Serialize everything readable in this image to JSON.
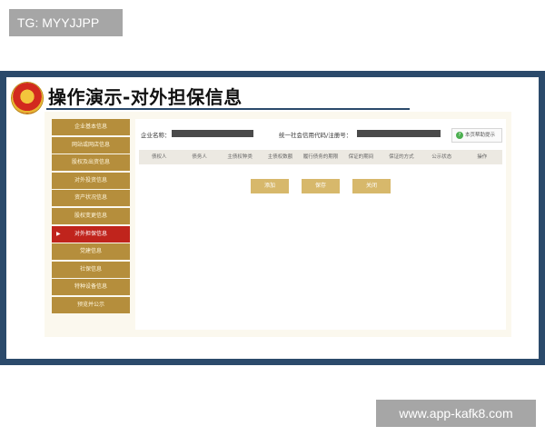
{
  "watermark_top": "TG: MYYJJPP",
  "watermark_bottom": "www.app-kafk8.com",
  "slide": {
    "title": "操作演示-对外担保信息"
  },
  "app": {
    "company_label": "企业名称：",
    "credit_code_label": "统一社会信用代码/注册号：",
    "print_button": "本页帮助提示",
    "sidebar": [
      {
        "label": "企业基本信息",
        "active": false
      },
      {
        "label": "网站或网店信息",
        "active": false
      },
      {
        "label": "股权及出资信息",
        "active": false
      },
      {
        "label": "对外投资信息",
        "active": false
      },
      {
        "label": "资产状况信息",
        "active": false
      },
      {
        "label": "股权变更信息",
        "active": false
      },
      {
        "label": "对外担保信息",
        "active": true
      },
      {
        "label": "党建信息",
        "active": false
      },
      {
        "label": "社保信息",
        "active": false
      },
      {
        "label": "特种设备信息",
        "active": false
      },
      {
        "label": "预览并公示",
        "active": false
      }
    ],
    "table_headers": [
      "债权人",
      "债务人",
      "主债权种类",
      "主债权数额",
      "履行债务的期限",
      "保证的期间",
      "保证的方式",
      "公示状态",
      "操作"
    ],
    "buttons": {
      "add": "添加",
      "save": "保存",
      "close": "关闭"
    },
    "colors": {
      "sidebar_item": "#b58e3c",
      "sidebar_active": "#c0241c",
      "action_button": "#d7b86b"
    }
  }
}
